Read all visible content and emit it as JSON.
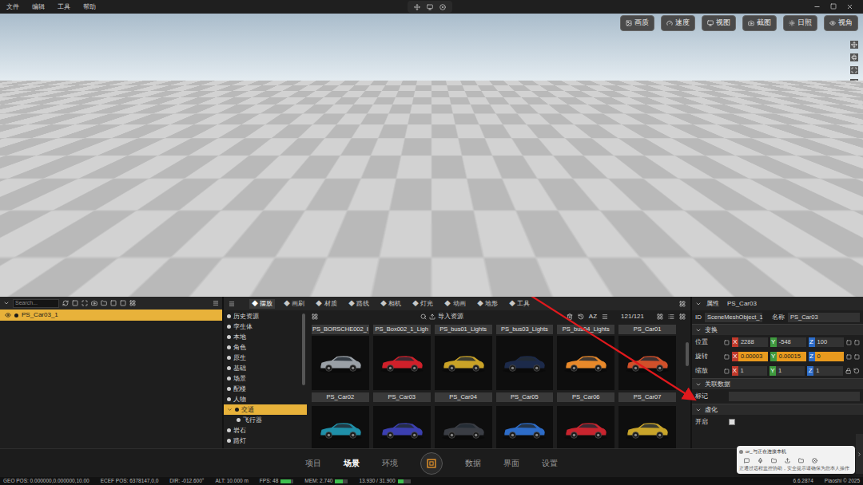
{
  "menu": [
    "文件",
    "编辑",
    "工具",
    "帮助"
  ],
  "viewport_toolbar": [
    "画质",
    "速度",
    "视图",
    "截图",
    "日照",
    "视角"
  ],
  "outliner": {
    "search_placeholder": "Search...",
    "items": [
      {
        "label": "PS_Car03_1",
        "selected": true
      }
    ]
  },
  "asset_tabs": [
    {
      "label": "摆放",
      "selected": true
    },
    {
      "label": "画刷",
      "selected": false
    },
    {
      "label": "材质",
      "selected": false
    },
    {
      "label": "路线",
      "selected": false
    },
    {
      "label": "相机",
      "selected": false
    },
    {
      "label": "灯光",
      "selected": false
    },
    {
      "label": "动画",
      "selected": false
    },
    {
      "label": "地形",
      "selected": false
    },
    {
      "label": "工具",
      "selected": false
    }
  ],
  "categories": [
    {
      "label": "历史资源",
      "selected": false,
      "kind": "group"
    },
    {
      "label": "孪生体",
      "selected": false,
      "kind": "group"
    },
    {
      "label": "本地",
      "selected": false,
      "kind": "group"
    },
    {
      "label": "角色",
      "selected": false,
      "kind": "group"
    },
    {
      "label": "原生",
      "selected": false,
      "kind": "group"
    },
    {
      "label": "基础",
      "selected": false,
      "kind": "group"
    },
    {
      "label": "场景",
      "selected": false,
      "kind": "group"
    },
    {
      "label": "配楼",
      "selected": false,
      "kind": "group"
    },
    {
      "label": "人物",
      "selected": false,
      "kind": "group"
    },
    {
      "label": "交通",
      "selected": true,
      "kind": "group"
    },
    {
      "label": "飞行器",
      "selected": false,
      "kind": "child"
    },
    {
      "label": "岩石",
      "selected": false,
      "kind": "group"
    },
    {
      "label": "路灯",
      "selected": false,
      "kind": "group"
    }
  ],
  "assets": {
    "import_label": "导入资源",
    "sort_label": "AZ",
    "count": "121/121",
    "label_row": [
      "PS_BORSCHE002_I",
      "PS_Box002_1_Ligh",
      "PS_bus01_Lights",
      "PS_bus03_Lights",
      "PS_bus04_Lights",
      "PS_Car01"
    ],
    "items": [
      {
        "name": "PS_Car02",
        "color": "#9aa0a6"
      },
      {
        "name": "PS_Car03",
        "color": "#d0202a"
      },
      {
        "name": "PS_Car04",
        "color": "#c9a227"
      },
      {
        "name": "PS_Car05",
        "color": "#1c2a4a"
      },
      {
        "name": "PS_Car06",
        "color": "#e8892a"
      },
      {
        "name": "PS_Car07",
        "color": "#d0502a"
      }
    ],
    "more": [
      {
        "color": "#1f8fa8"
      },
      {
        "color": "#3b3fb0"
      },
      {
        "color": "#3a3d44"
      },
      {
        "color": "#2d6cc8"
      },
      {
        "color": "#c8242e"
      },
      {
        "color": "#c8a42a"
      }
    ]
  },
  "properties": {
    "title": "属性",
    "object": "PS_Car03",
    "id_label": "ID",
    "id": "SceneMeshObject_1",
    "name_label": "名称",
    "name": "PS_Car03",
    "sections": [
      {
        "title": "变换",
        "kind": "transform",
        "rows": [
          {
            "label": "位置",
            "values": [
              {
                "axis": "X",
                "value": "2288",
                "highlighted": false
              },
              {
                "axis": "Y",
                "value": "-548",
                "highlighted": false
              },
              {
                "axis": "Z",
                "value": "100",
                "highlighted": false
              }
            ]
          },
          {
            "label": "旋转",
            "values": [
              {
                "axis": "X",
                "value": "0.00003",
                "highlighted": true
              },
              {
                "axis": "Y",
                "value": "0.00015",
                "highlighted": true
              },
              {
                "axis": "Z",
                "value": "0",
                "highlighted": true
              }
            ]
          },
          {
            "label": "缩放",
            "values": [
              {
                "axis": "X",
                "value": "1",
                "highlighted": false
              },
              {
                "axis": "Y",
                "value": "1",
                "highlighted": false
              },
              {
                "axis": "Z",
                "value": "1",
                "highlighted": false
              }
            ]
          }
        ]
      },
      {
        "title": "关联数据",
        "kind": "fields",
        "fields": [
          {
            "label": "标记",
            "value": ""
          }
        ]
      },
      {
        "title": "虚化",
        "kind": "toggles",
        "toggles": [
          {
            "label": "开启",
            "checked": false
          }
        ]
      }
    ]
  },
  "bottom_nav": {
    "left": [
      {
        "label": "项目",
        "selected": false
      },
      {
        "label": "场景",
        "selected": true
      },
      {
        "label": "环境",
        "selected": false
      }
    ],
    "right": [
      {
        "label": "数据",
        "selected": false
      },
      {
        "label": "界面",
        "selected": false
      },
      {
        "label": "设置",
        "selected": false
      }
    ]
  },
  "status_bar": {
    "left": [
      {
        "text": "GEO POS: 0.000000,0.000000,10.00",
        "kind": "text"
      },
      {
        "text": "ECEF POS: 6378147,0,0",
        "kind": "text"
      },
      {
        "text": "DIR: -012.600°",
        "kind": "text"
      },
      {
        "text": "ALT: 10.000 m",
        "kind": "text"
      },
      {
        "text": "FPS: 48",
        "kind": "meter",
        "level": 0.8
      },
      {
        "text": "MEM: 2.740",
        "kind": "meter",
        "level": 0.6
      },
      {
        "text": "13.930 / 31.900",
        "kind": "meter",
        "level": 0.44
      }
    ],
    "right": [
      "6.6.2874",
      "Piaoshi © 2025"
    ]
  },
  "notification": {
    "title": "or_与正在连接本机",
    "text": "正通过远程监控协助，安全提示请确保为您本人操作"
  }
}
